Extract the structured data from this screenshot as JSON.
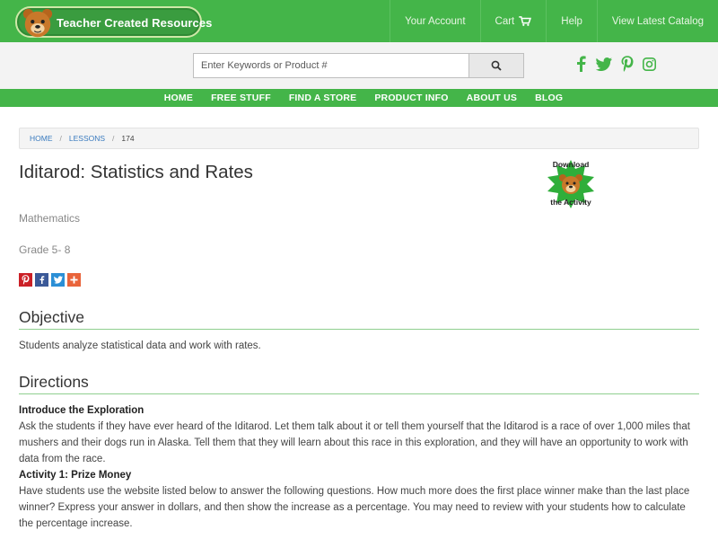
{
  "header": {
    "logo_text": "Teacher Created Resources",
    "nav": [
      {
        "label": "Your Account"
      },
      {
        "label": "Cart"
      },
      {
        "label": "Help"
      },
      {
        "label": "View Latest Catalog"
      }
    ]
  },
  "search": {
    "placeholder": "Enter Keywords or Product #",
    "value": ""
  },
  "social_icons": [
    "facebook-icon",
    "twitter-icon",
    "pinterest-icon",
    "instagram-icon"
  ],
  "main_nav": [
    {
      "label": "HOME"
    },
    {
      "label": "FREE STUFF"
    },
    {
      "label": "FIND A STORE"
    },
    {
      "label": "PRODUCT INFO"
    },
    {
      "label": "ABOUT US"
    },
    {
      "label": "BLOG"
    }
  ],
  "breadcrumb": [
    {
      "label": "HOME"
    },
    {
      "label": "LESSONS"
    },
    {
      "label": "174"
    }
  ],
  "lesson": {
    "title": "Iditarod: Statistics and Rates",
    "download_line1": "Download",
    "download_line2": "the Activity",
    "subject": "Mathematics",
    "grade": "Grade 5- 8"
  },
  "share_buttons": [
    "pinterest-share-icon",
    "facebook-share-icon",
    "twitter-share-icon",
    "more-share-icon"
  ],
  "objective": {
    "heading": "Objective",
    "text": "Students analyze statistical data and work with rates."
  },
  "directions": {
    "heading": "Directions",
    "intro_heading": "Introduce the Exploration",
    "intro_text": "Ask the students if they have ever heard of the Iditarod. Let them talk about it or tell them yourself that the Iditarod is a race of over 1,000 miles that mushers and their dogs run in Alaska. Tell them that they will learn about this race in this exploration, and they will have an opportunity to work with data from the race.",
    "activity1_heading": "Activity 1: Prize Money",
    "activity1_text": "Have students use the website listed below to answer the following questions. How much more does the first place winner make than the last place winner? Express your answer in dollars, and then show the increase as a percentage. You may need to review with your students how to calculate the percentage increase."
  },
  "colors": {
    "brand_green": "#44b549",
    "link_blue": "#3a7bbf",
    "rule_green": "#8fcf8f"
  }
}
